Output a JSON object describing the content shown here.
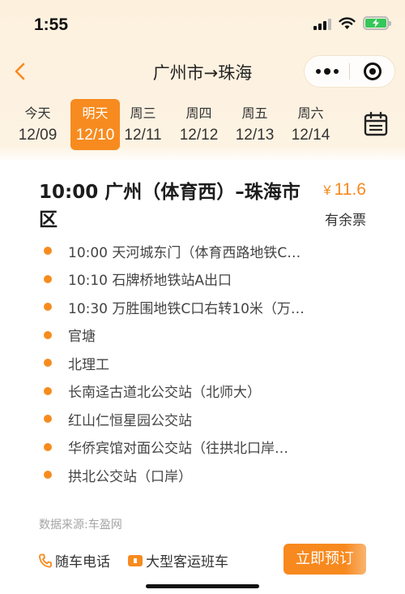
{
  "status_bar": {
    "time": "1:55"
  },
  "nav": {
    "title": "广州市→珠海"
  },
  "dates": [
    {
      "dow": "今天",
      "md": "12/09",
      "active": false
    },
    {
      "dow": "明天",
      "md": "12/10",
      "active": true
    },
    {
      "dow": "周三",
      "md": "12/11",
      "active": false
    },
    {
      "dow": "周四",
      "md": "12/12",
      "active": false
    },
    {
      "dow": "周五",
      "md": "12/13",
      "active": false
    },
    {
      "dow": "周六",
      "md": "12/14",
      "active": false
    }
  ],
  "trip": {
    "title": "10:00 广州（体育西）–珠海市区",
    "currency": "¥",
    "price": "11.6",
    "ticket_status": "有余票",
    "stops": [
      "10:00 天河城东门（体育西路地铁C…",
      "10:10 石牌桥地铁站A出口",
      "10:30 万胜围地铁C口右转10米（万…",
      "官塘",
      "北理工",
      "长南迳古道北公交站（北师大）",
      "红山仁恒星园公交站",
      "华侨宾馆对面公交站（往拱北口岸…",
      "拱北公交站（口岸）"
    ]
  },
  "footer": {
    "source": "数据来源:车盈网",
    "phone_label": "随车电话",
    "bus_type": "大型客运班车",
    "book_label": "立即预订"
  },
  "colors": {
    "accent": "#f78b1f",
    "background_top": "#fdf1de"
  },
  "icons": {
    "back": "chevron-left-icon",
    "more": "more-dots-icon",
    "close": "target-icon",
    "calendar": "calendar-icon",
    "phone": "phone-icon",
    "bus": "bus-badge-icon"
  }
}
